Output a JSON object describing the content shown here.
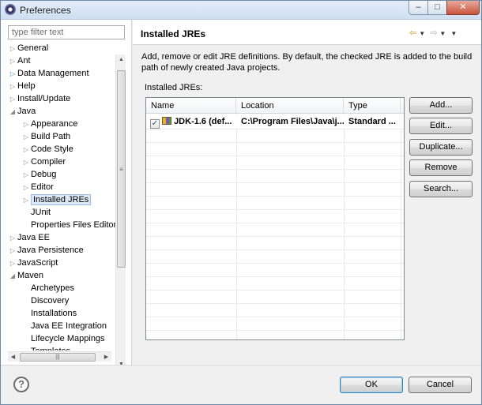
{
  "window": {
    "title": "Preferences"
  },
  "filter": {
    "placeholder": "type filter text"
  },
  "tree": [
    {
      "label": "General",
      "twisty": "▷",
      "blue": false,
      "indent": 0,
      "selected": false
    },
    {
      "label": "Ant",
      "twisty": "▷",
      "blue": false,
      "indent": 0,
      "selected": false
    },
    {
      "label": "Data Management",
      "twisty": "▷",
      "blue": true,
      "indent": 0,
      "selected": false
    },
    {
      "label": "Help",
      "twisty": "▷",
      "blue": false,
      "indent": 0,
      "selected": false
    },
    {
      "label": "Install/Update",
      "twisty": "▷",
      "blue": false,
      "indent": 0,
      "selected": false
    },
    {
      "label": "Java",
      "twisty": "◢",
      "blue": false,
      "indent": 0,
      "selected": false
    },
    {
      "label": "Appearance",
      "twisty": "▷",
      "blue": false,
      "indent": 1,
      "selected": false
    },
    {
      "label": "Build Path",
      "twisty": "▷",
      "blue": false,
      "indent": 1,
      "selected": false
    },
    {
      "label": "Code Style",
      "twisty": "▷",
      "blue": false,
      "indent": 1,
      "selected": false
    },
    {
      "label": "Compiler",
      "twisty": "▷",
      "blue": false,
      "indent": 1,
      "selected": false
    },
    {
      "label": "Debug",
      "twisty": "▷",
      "blue": false,
      "indent": 1,
      "selected": false
    },
    {
      "label": "Editor",
      "twisty": "▷",
      "blue": false,
      "indent": 1,
      "selected": false
    },
    {
      "label": "Installed JREs",
      "twisty": "▷",
      "blue": false,
      "indent": 1,
      "selected": true
    },
    {
      "label": "JUnit",
      "twisty": "",
      "blue": false,
      "indent": 1,
      "selected": false
    },
    {
      "label": "Properties Files Editor",
      "twisty": "",
      "blue": false,
      "indent": 1,
      "selected": false
    },
    {
      "label": "Java EE",
      "twisty": "▷",
      "blue": false,
      "indent": 0,
      "selected": false
    },
    {
      "label": "Java Persistence",
      "twisty": "▷",
      "blue": false,
      "indent": 0,
      "selected": false
    },
    {
      "label": "JavaScript",
      "twisty": "▷",
      "blue": false,
      "indent": 0,
      "selected": false
    },
    {
      "label": "Maven",
      "twisty": "◢",
      "blue": false,
      "indent": 0,
      "selected": false
    },
    {
      "label": "Archetypes",
      "twisty": "",
      "blue": false,
      "indent": 1,
      "selected": false
    },
    {
      "label": "Discovery",
      "twisty": "",
      "blue": false,
      "indent": 1,
      "selected": false
    },
    {
      "label": "Installations",
      "twisty": "",
      "blue": false,
      "indent": 1,
      "selected": false
    },
    {
      "label": "Java EE Integration",
      "twisty": "",
      "blue": false,
      "indent": 1,
      "selected": false
    },
    {
      "label": "Lifecycle Mappings",
      "twisty": "",
      "blue": false,
      "indent": 1,
      "selected": false
    },
    {
      "label": "Templates",
      "twisty": "",
      "blue": false,
      "indent": 1,
      "selected": false
    }
  ],
  "page": {
    "title": "Installed JREs",
    "description": "Add, remove or edit JRE definitions. By default, the checked JRE is added to the build path of newly created Java projects.",
    "list_label": "Installed JREs:"
  },
  "table": {
    "columns": [
      "Name",
      "Location",
      "Type"
    ],
    "rows": [
      {
        "checked": true,
        "name": "JDK-1.6 (def...",
        "location": "C:\\Program Files\\Java\\j...",
        "type": "Standard ..."
      }
    ]
  },
  "buttons": {
    "add": "Add...",
    "edit": "Edit...",
    "duplicate": "Duplicate...",
    "remove": "Remove",
    "search": "Search..."
  },
  "footer": {
    "help": "?",
    "ok": "OK",
    "cancel": "Cancel"
  },
  "icons": {
    "window": "eclipse-icon",
    "back": "back-arrow-icon",
    "forward": "forward-arrow-icon",
    "help": "help-icon",
    "jre": "jre-library-icon"
  },
  "colors": {
    "selection": "#dbe9f7",
    "nav_arrow": "#c89a1a",
    "ok_border": "#3c7fb1"
  }
}
